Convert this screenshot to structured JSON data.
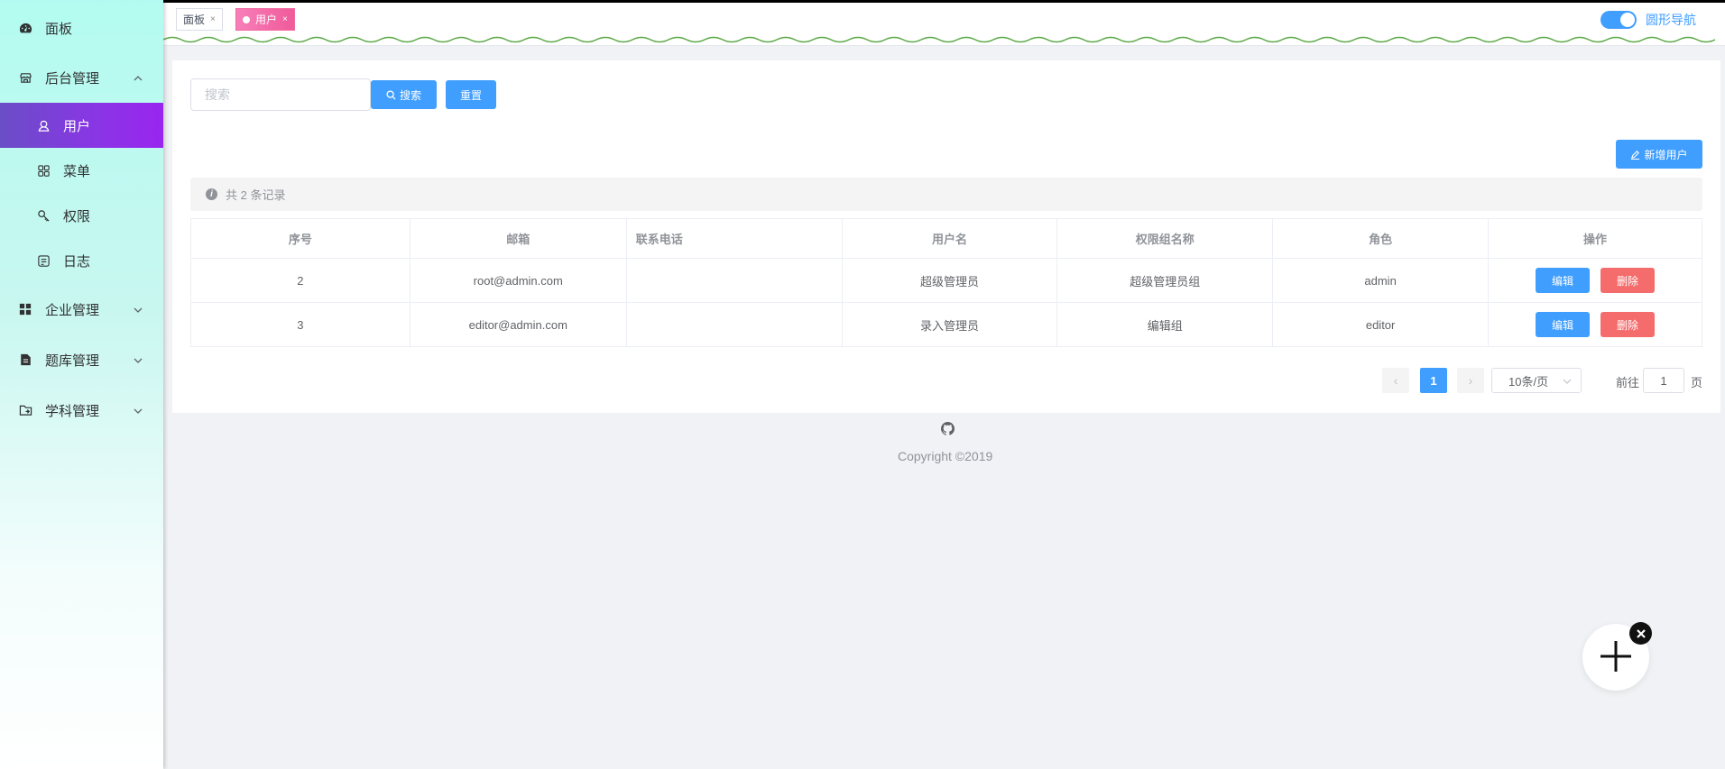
{
  "sidebar": {
    "items": [
      {
        "label": "面板",
        "icon": "dashboard-icon"
      },
      {
        "label": "后台管理",
        "icon": "shop-icon",
        "expanded": true
      },
      {
        "label": "用户",
        "icon": "user-icon",
        "active": true
      },
      {
        "label": "菜单",
        "icon": "menu-grid-icon"
      },
      {
        "label": "权限",
        "icon": "key-icon"
      },
      {
        "label": "日志",
        "icon": "log-icon"
      },
      {
        "label": "企业管理",
        "icon": "grid-icon"
      },
      {
        "label": "题库管理",
        "icon": "document-icon"
      },
      {
        "label": "学科管理",
        "icon": "folder-icon"
      }
    ]
  },
  "tabs": [
    {
      "label": "面板",
      "close": "×"
    },
    {
      "label": "用户",
      "close": "×",
      "active": true
    }
  ],
  "topbar": {
    "switch_label": "圆形导航",
    "switch_on": true
  },
  "search": {
    "placeholder": "搜索",
    "search_label": "搜索",
    "reset_label": "重置"
  },
  "add_user_label": "新增用户",
  "info": {
    "text": "共 2 条记录",
    "icon_glyph": "i"
  },
  "table": {
    "headers": [
      "序号",
      "邮箱",
      "联系电话",
      "用户名",
      "权限组名称",
      "角色",
      "操作"
    ],
    "rows": [
      {
        "id": "2",
        "email": "root@admin.com",
        "phone": "",
        "username": "超级管理员",
        "group": "超级管理员组",
        "role": "admin",
        "edit": "编辑",
        "delete": "删除"
      },
      {
        "id": "3",
        "email": "editor@admin.com",
        "phone": "",
        "username": "录入管理员",
        "group": "编辑组",
        "role": "editor",
        "edit": "编辑",
        "delete": "删除"
      }
    ]
  },
  "pagination": {
    "prev": "‹",
    "current": "1",
    "next": "›",
    "page_size": "10条/页",
    "goto_prefix": "前往",
    "goto_value": "1",
    "goto_suffix": "页"
  },
  "footer": {
    "copyright": "Copyright ©2019",
    "icon": "github-icon"
  },
  "colors": {
    "primary": "#409eff",
    "danger": "#f56c6c",
    "active_menu": "#8a35e6",
    "active_tag": "#f05a9a"
  }
}
